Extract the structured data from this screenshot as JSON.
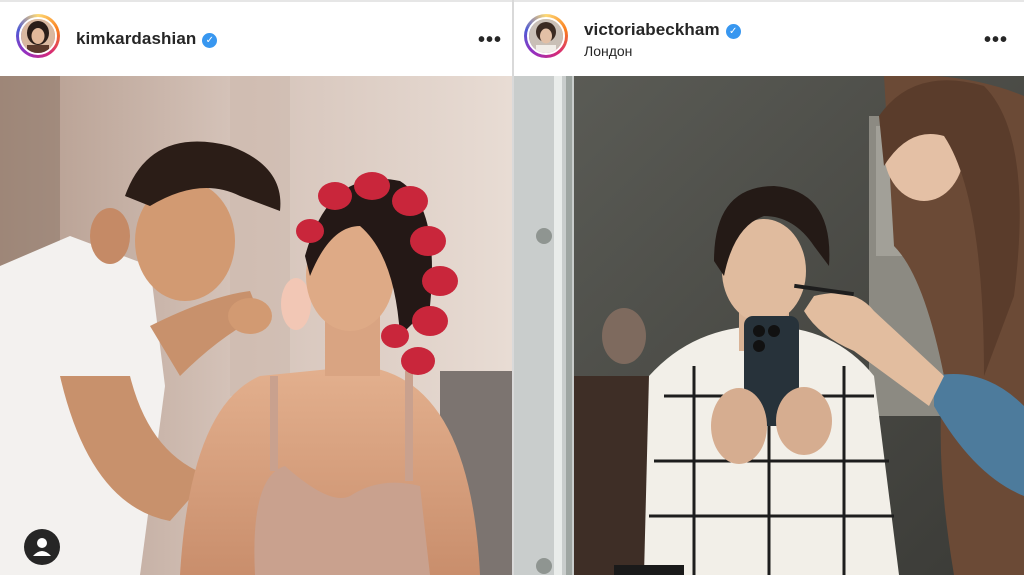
{
  "posts": [
    {
      "username": "kimkardashian",
      "verified": true,
      "location": "",
      "more_icon": "more-horizontal-icon",
      "photo": "Makeup artist powdering woman in pink hair rollers",
      "has_user_tags": true
    },
    {
      "username": "victoriabeckham",
      "verified": true,
      "location": "Лондон",
      "more_icon": "more-horizontal-icon",
      "photo": "Woman taking mirror selfie while makeup is applied",
      "has_user_tags": false
    }
  ],
  "colors": {
    "verified_badge": "#3897f0",
    "text": "#262626",
    "avatar_ring": [
      "#feda75",
      "#fa7e1e",
      "#d62976",
      "#962fbf",
      "#4f5bd5"
    ]
  }
}
